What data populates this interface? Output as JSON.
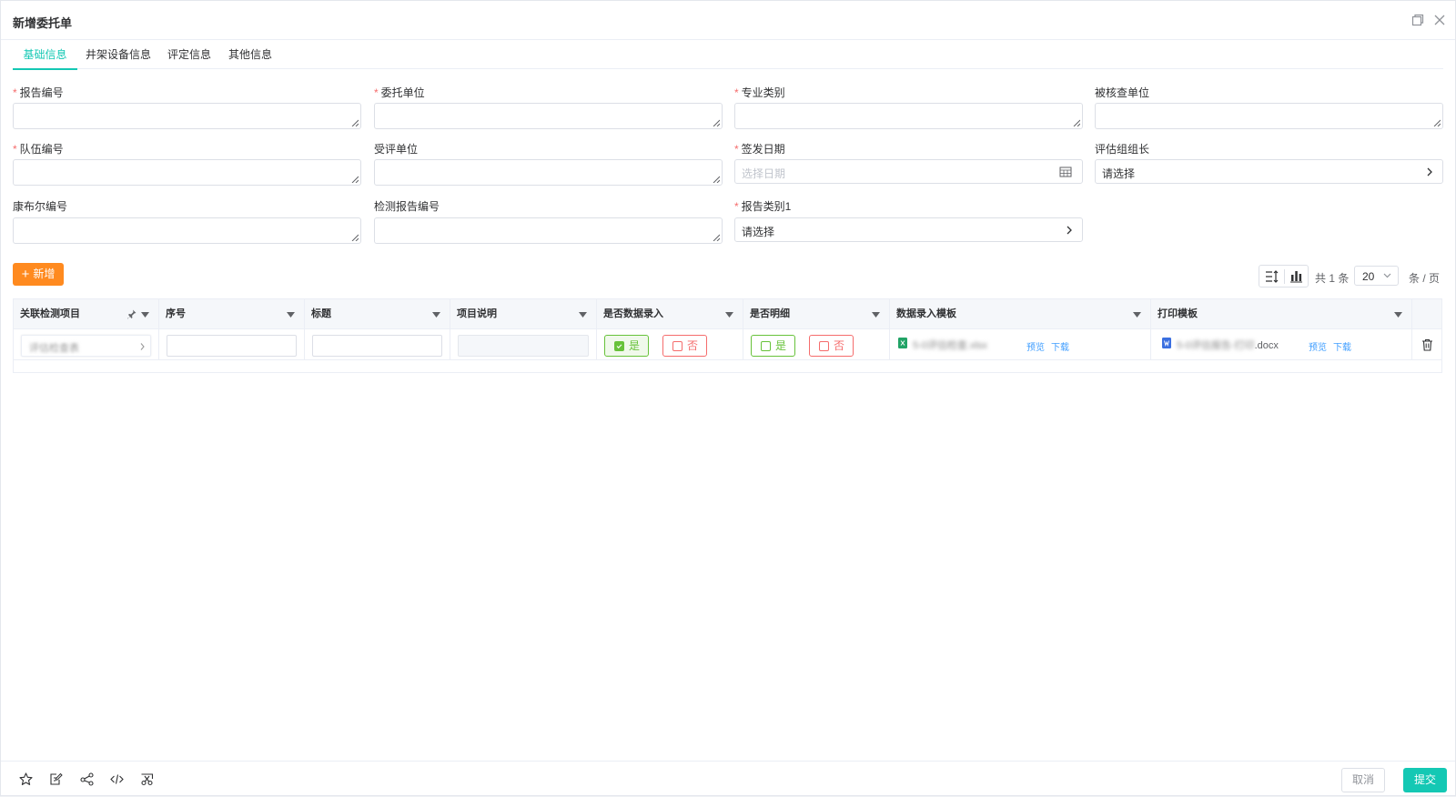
{
  "dialog": {
    "title": "新增委托单"
  },
  "tabs": [
    {
      "label": "基础信息",
      "active": true
    },
    {
      "label": "井架设备信息",
      "active": false
    },
    {
      "label": "评定信息",
      "active": false
    },
    {
      "label": "其他信息",
      "active": false
    }
  ],
  "form": {
    "report_no": {
      "label": "报告编号",
      "required": true,
      "value": ""
    },
    "client_unit": {
      "label": "委托单位",
      "required": true,
      "value": ""
    },
    "specialty": {
      "label": "专业类别",
      "required": true,
      "value": ""
    },
    "inspected_unit": {
      "label": "被核查单位",
      "required": false,
      "value": ""
    },
    "team_no": {
      "label": "队伍编号",
      "required": true,
      "value": ""
    },
    "evaluated_unit": {
      "label": "受评单位",
      "required": false,
      "value": ""
    },
    "issue_date": {
      "label": "签发日期",
      "required": true,
      "placeholder": "选择日期",
      "value": ""
    },
    "team_leader": {
      "label": "评估组组长",
      "required": false,
      "value": "请选择"
    },
    "kangbuer_no": {
      "label": "康布尔编号",
      "required": false,
      "value": ""
    },
    "test_report_no": {
      "label": "检测报告编号",
      "required": false,
      "value": ""
    },
    "report_type": {
      "label": "报告类别1",
      "required": true,
      "value": "请选择"
    }
  },
  "toolbar": {
    "add_label": "新增",
    "total_text": "共 1 条",
    "page_size": "20",
    "per_page_text": "条 / 页"
  },
  "table": {
    "columns": [
      "关联检测项目",
      "序号",
      "标题",
      "项目说明",
      "是否数据录入",
      "是否明细",
      "数据录入模板",
      "打印模板"
    ],
    "rows": [
      {
        "project": "评估检查表",
        "seq": "",
        "title": "",
        "desc": "",
        "data_entry": {
          "yes": "是",
          "no": "否",
          "selected": "yes"
        },
        "detail": {
          "yes": "是",
          "no": "否",
          "selected": "none"
        },
        "entry_template": {
          "name": "5-0评估检查.xlsx",
          "preview": "预览",
          "download": "下载"
        },
        "print_template": {
          "name_blur": "5-0评估报告-打印",
          "name_ext": ".docx",
          "preview": "预览",
          "download": "下载"
        }
      }
    ]
  },
  "footer": {
    "cancel_label": "取消",
    "submit_label": "提交"
  },
  "colors": {
    "accent": "#14c8b4",
    "add": "#ff8a1f",
    "yes": "#67c23a",
    "no": "#f56c6c",
    "link": "#409eff"
  }
}
